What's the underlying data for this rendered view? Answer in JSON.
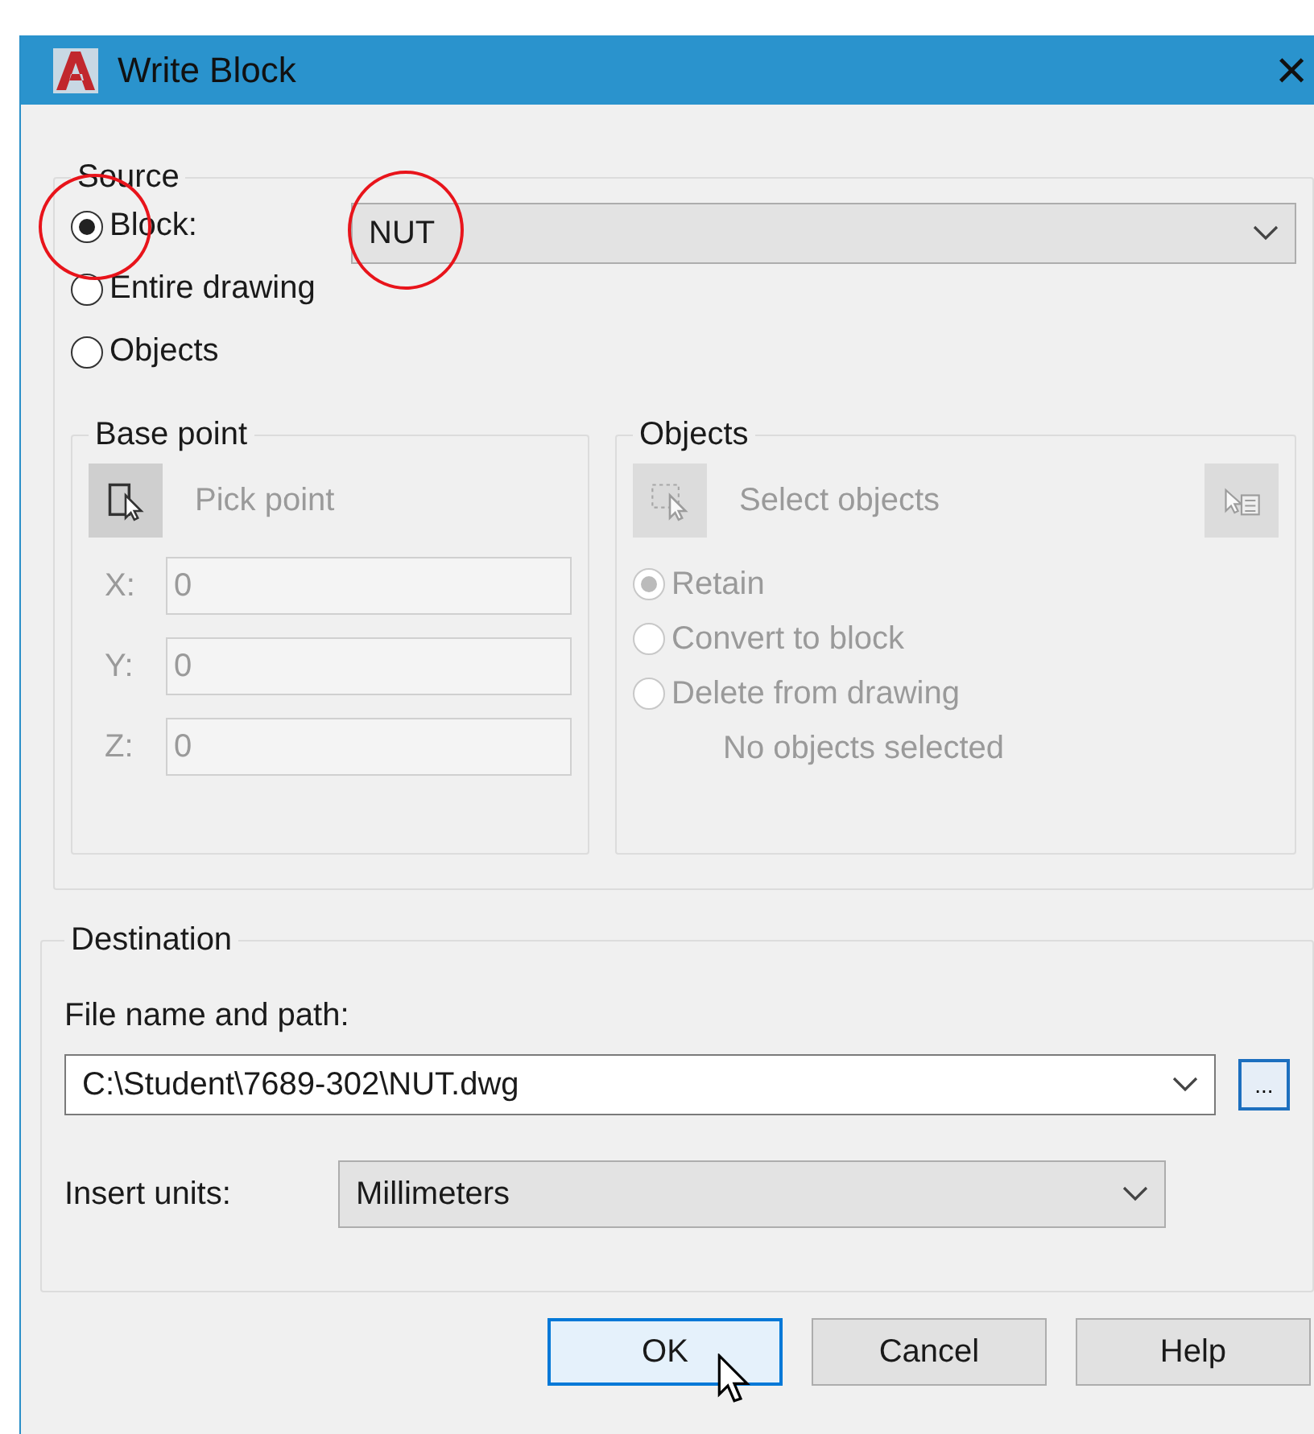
{
  "window": {
    "title": "Write Block",
    "close": "×"
  },
  "source": {
    "legend": "Source",
    "options": [
      {
        "label": "Block:",
        "selected": true,
        "highlighted": true
      },
      {
        "label": "Entire drawing",
        "selected": false,
        "highlighted": false
      },
      {
        "label": "Objects",
        "selected": false,
        "highlighted": false
      }
    ],
    "block_name": {
      "value": "NUT",
      "highlighted": true
    }
  },
  "base_point": {
    "legend": "Base point",
    "button": "Pick point",
    "disabled": true,
    "fields": [
      {
        "label": "X:",
        "value": "0"
      },
      {
        "label": "Y:",
        "value": "0"
      },
      {
        "label": "Z:",
        "value": "0"
      }
    ]
  },
  "objects": {
    "legend": "Objects",
    "button": "Select objects",
    "disabled": true,
    "options": [
      {
        "label": "Retain",
        "selected": true
      },
      {
        "label": "Convert to block",
        "selected": false
      },
      {
        "label": "Delete from drawing",
        "selected": false
      }
    ],
    "status": "No objects selected"
  },
  "destination": {
    "legend": "Destination",
    "file_label": "File name and path:",
    "file_value": "C:\\Student\\7689-302\\NUT.dwg",
    "browse": "...",
    "units_label": "Insert units:",
    "units_value": "Millimeters"
  },
  "buttons": [
    {
      "label": "OK",
      "default": true
    },
    {
      "label": "Cancel",
      "default": false
    },
    {
      "label": "Help",
      "default": false
    }
  ]
}
